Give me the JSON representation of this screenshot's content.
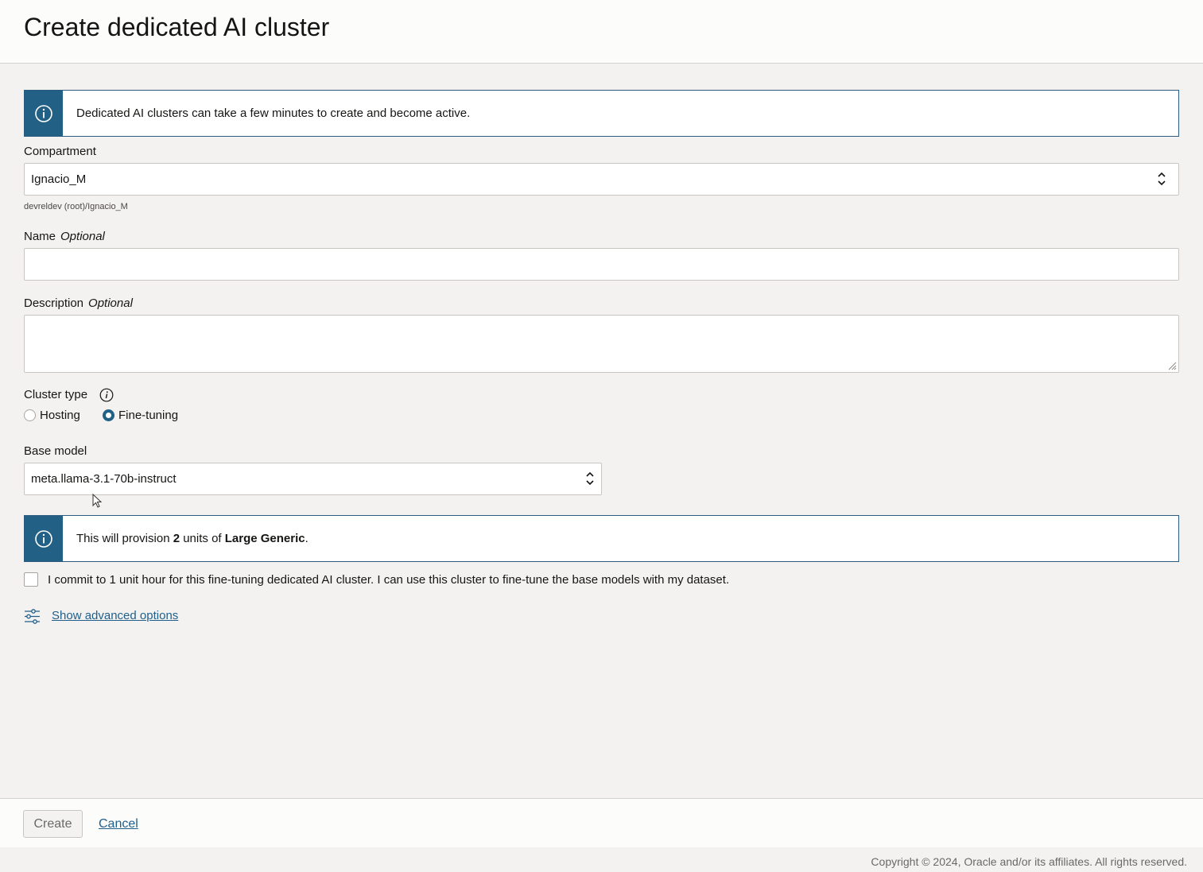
{
  "header": {
    "title": "Create dedicated AI cluster"
  },
  "info_banner": {
    "text": "Dedicated AI clusters can take a few minutes to create and become active."
  },
  "compartment": {
    "label": "Compartment",
    "value": "Ignacio_M",
    "path_hint": "devreldev (root)/Ignacio_M"
  },
  "name_field": {
    "label": "Name",
    "optional": "Optional",
    "value": ""
  },
  "description_field": {
    "label": "Description",
    "optional": "Optional",
    "value": ""
  },
  "cluster_type": {
    "label": "Cluster type",
    "options": [
      {
        "label": "Hosting",
        "selected": false
      },
      {
        "label": "Fine-tuning",
        "selected": true
      }
    ]
  },
  "base_model": {
    "label": "Base model",
    "value": "meta.llama-3.1-70b-instruct"
  },
  "provision_banner": {
    "prefix": "This will provision ",
    "units": "2",
    "middle": " units of ",
    "shape": "Large Generic",
    "suffix": "."
  },
  "commit_checkbox": {
    "checked": false,
    "label": "I commit to 1 unit hour for this fine-tuning dedicated AI cluster. I can use this cluster to fine-tune the base models with my dataset."
  },
  "advanced": {
    "label": "Show advanced options"
  },
  "footer": {
    "create_label": "Create",
    "cancel_label": "Cancel",
    "copyright": "Copyright © 2024, Oracle and/or its affiliates. All rights reserved."
  },
  "colors": {
    "accent": "#226086",
    "link": "#1f5f8b"
  },
  "icons": [
    "info-icon",
    "chevron-updown-icon",
    "sliders-icon",
    "resize-handle-icon"
  ]
}
